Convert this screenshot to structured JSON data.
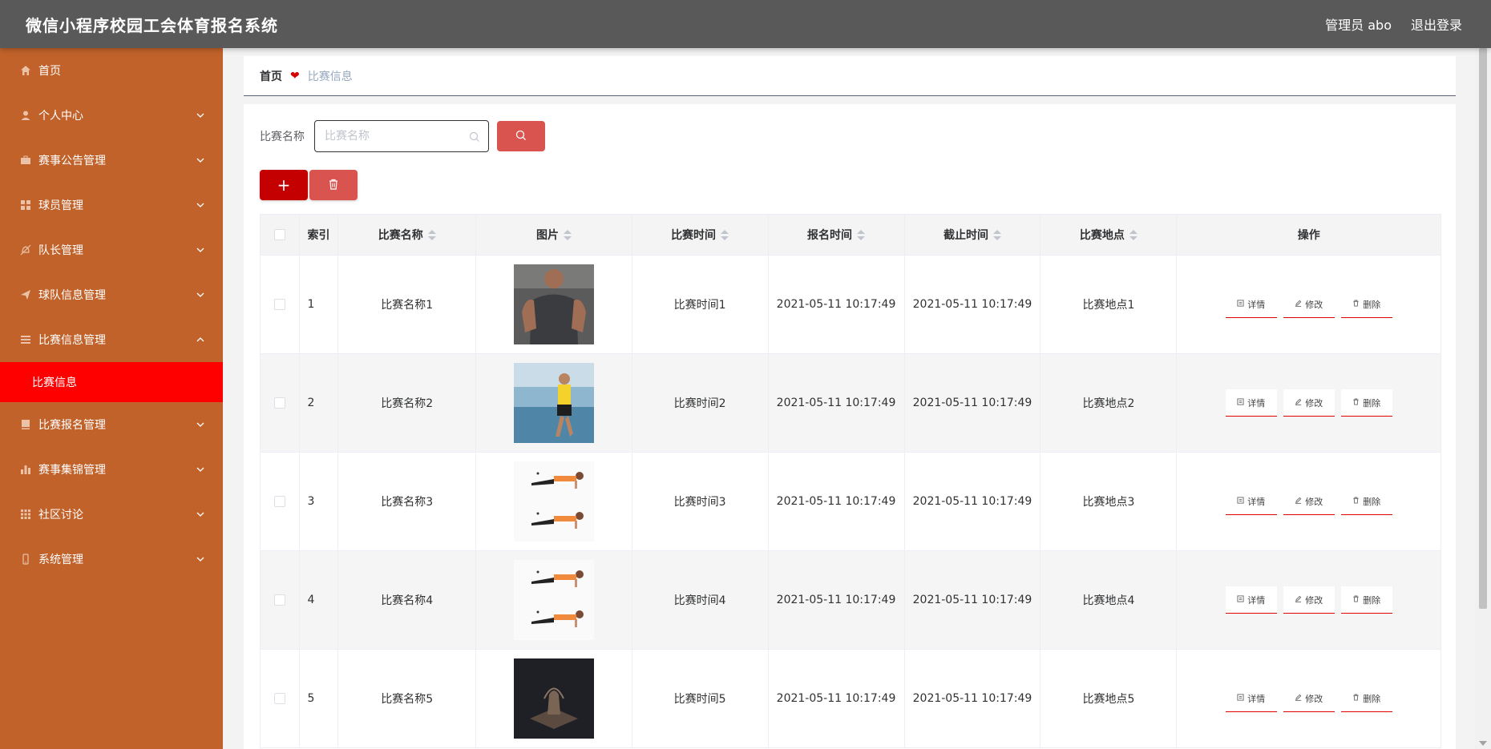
{
  "header": {
    "title": "微信小程序校园工会体育报名系统",
    "user_label": "管理员 abo",
    "logout_label": "退出登录"
  },
  "sidebar": {
    "items": [
      {
        "label": "首页",
        "icon": "home-icon",
        "has_children": false
      },
      {
        "label": "个人中心",
        "icon": "user-icon",
        "has_children": true
      },
      {
        "label": "赛事公告管理",
        "icon": "briefcase-icon",
        "has_children": true
      },
      {
        "label": "球员管理",
        "icon": "grid-icon",
        "has_children": true
      },
      {
        "label": "队长管理",
        "icon": "bell-off-icon",
        "has_children": true
      },
      {
        "label": "球队信息管理",
        "icon": "send-icon",
        "has_children": true
      },
      {
        "label": "比赛信息管理",
        "icon": "list-icon",
        "has_children": true,
        "expanded": true
      },
      {
        "label": "比赛报名管理",
        "icon": "book-icon",
        "has_children": true
      },
      {
        "label": "赛事集锦管理",
        "icon": "bar-chart-icon",
        "has_children": true
      },
      {
        "label": "社区讨论",
        "icon": "apps-icon",
        "has_children": true
      },
      {
        "label": "系统管理",
        "icon": "phone-icon",
        "has_children": true
      }
    ],
    "sub_item_active": "比赛信息",
    "active_color": "#ff0000",
    "bg_color": "#c1622a"
  },
  "breadcrumb": {
    "home": "首页",
    "current": "比赛信息"
  },
  "search": {
    "label": "比赛名称",
    "placeholder": "比赛名称",
    "value": ""
  },
  "table": {
    "headers": [
      "索引",
      "比赛名称",
      "图片",
      "比赛时间",
      "报名时间",
      "截止时间",
      "比赛地点",
      "操作"
    ],
    "rows": [
      {
        "index": "1",
        "name": "比赛名称1",
        "image": "muscle-man-photo",
        "match_time": "比赛时间1",
        "signup_time": "2021-05-11 10:17:49",
        "deadline": "2021-05-11 10:17:49",
        "location": "比赛地点1"
      },
      {
        "index": "2",
        "name": "比赛名称2",
        "image": "runner-photo",
        "match_time": "比赛时间2",
        "signup_time": "2021-05-11 10:17:49",
        "deadline": "2021-05-11 10:17:49",
        "location": "比赛地点2"
      },
      {
        "index": "3",
        "name": "比赛名称3",
        "image": "plank-photo",
        "match_time": "比赛时间3",
        "signup_time": "2021-05-11 10:17:49",
        "deadline": "2021-05-11 10:17:49",
        "location": "比赛地点3"
      },
      {
        "index": "4",
        "name": "比赛名称4",
        "image": "plank-photo",
        "match_time": "比赛时间4",
        "signup_time": "2021-05-11 10:17:49",
        "deadline": "2021-05-11 10:17:49",
        "location": "比赛地点4"
      },
      {
        "index": "5",
        "name": "比赛名称5",
        "image": "dark-sculpture-photo",
        "match_time": "比赛时间5",
        "signup_time": "2021-05-11 10:17:49",
        "deadline": "2021-05-11 10:17:49",
        "location": "比赛地点5"
      }
    ],
    "actions": {
      "detail": "详情",
      "edit": "修改",
      "delete": "删除"
    }
  },
  "buttons": {
    "add": "+",
    "add_color": "#c40000",
    "delete_color": "#d9534f",
    "search_color": "#d9534f"
  }
}
